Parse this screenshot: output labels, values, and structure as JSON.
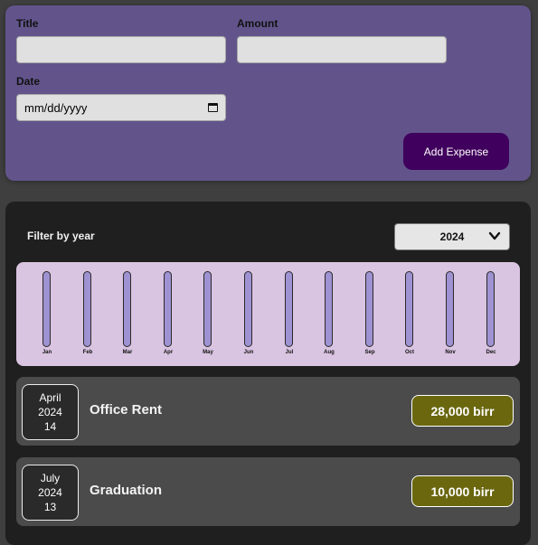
{
  "form": {
    "title_label": "Title",
    "title_value": "",
    "amount_label": "Amount",
    "amount_value": "",
    "date_label": "Date",
    "date_placeholder": "mm/dd/yyyy",
    "submit_label": "Add Expense"
  },
  "filter": {
    "label": "Filter by year",
    "selected_year": "2024"
  },
  "chart_data": {
    "type": "bar",
    "categories": [
      "Jan",
      "Feb",
      "Mar",
      "Apr",
      "May",
      "Jun",
      "Jul",
      "Aug",
      "Sep",
      "Oct",
      "Nov",
      "Dec"
    ],
    "values": [
      0,
      0,
      0,
      0,
      0,
      0,
      0,
      0,
      0,
      0,
      0,
      0
    ]
  },
  "expenses": [
    {
      "month": "April",
      "year": "2024",
      "day": "14",
      "title": "Office Rent",
      "amount": "28,000 birr"
    },
    {
      "month": "July",
      "year": "2024",
      "day": "13",
      "title": "Graduation",
      "amount": "10,000 birr"
    }
  ],
  "colors": {
    "form_background": "#62548b",
    "submit_button": "#40005d",
    "chart_background": "#d9c4e1",
    "bar_empty": "#9f92d2",
    "price_badge": "#6a670f"
  },
  "icons": {
    "date_picker": "calendar-icon",
    "select": "chevron-down-icon"
  }
}
